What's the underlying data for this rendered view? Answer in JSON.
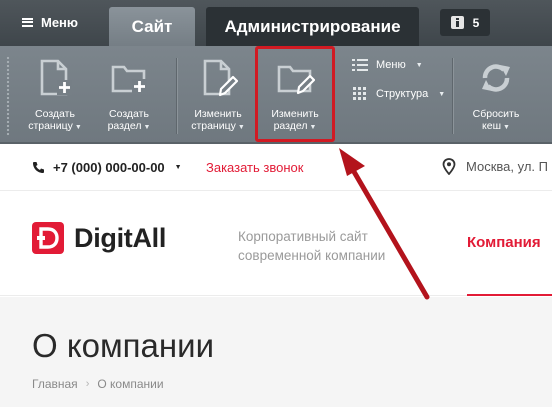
{
  "admin": {
    "menu_label": "Меню",
    "tab_site": "Сайт",
    "tab_admin": "Администрирование",
    "notifications_count": "5",
    "toolbar": {
      "create_page": [
        "Создать",
        "страницу"
      ],
      "create_section": [
        "Создать",
        "раздел"
      ],
      "edit_page": [
        "Изменить",
        "страницу"
      ],
      "edit_section": [
        "Изменить",
        "раздел"
      ],
      "menu": "Меню",
      "structure": "Структура",
      "reset_cache": [
        "Сбросить",
        "кеш"
      ]
    }
  },
  "site": {
    "phone": "+7 (000) 000-00-00",
    "callback": "Заказать звонок",
    "location": "Москва, ул. П",
    "logo_text": "DigitAll",
    "slogan": [
      "Корпоративный сайт",
      "современной компании"
    ],
    "nav_active": "Компания",
    "page_title": "О компании",
    "breadcrumb": [
      "Главная",
      "О компании"
    ]
  },
  "colors": {
    "accent": "#e21b36",
    "highlight": "#d11a23",
    "admin_dark": "#2b3135",
    "toolbar": "#767f86"
  }
}
